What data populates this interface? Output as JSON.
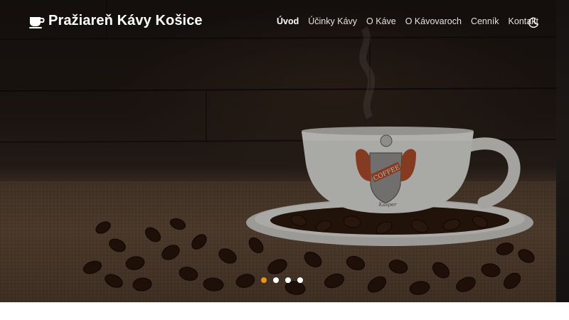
{
  "site": {
    "title": "Pražiareň Kávy Košice",
    "logo_icon": "coffee-cup-icon"
  },
  "nav": {
    "items": [
      {
        "label": "Úvod",
        "active": true
      },
      {
        "label": "Účinky Kávy",
        "active": false
      },
      {
        "label": "O Káve",
        "active": false
      },
      {
        "label": "O Kávovaroch",
        "active": false
      },
      {
        "label": "Cenník",
        "active": false
      },
      {
        "label": "Kontakt",
        "active": false
      }
    ],
    "theme_toggle_icon": "moon-icon"
  },
  "hero": {
    "cup_crest_text": "COFFEE",
    "cup_signature": "Kasper",
    "slides": {
      "count": 4,
      "active_index": 0
    }
  },
  "colors": {
    "accent": "#e8941c",
    "nav_text": "#e7e2df",
    "dark_bg": "#1b1512"
  }
}
